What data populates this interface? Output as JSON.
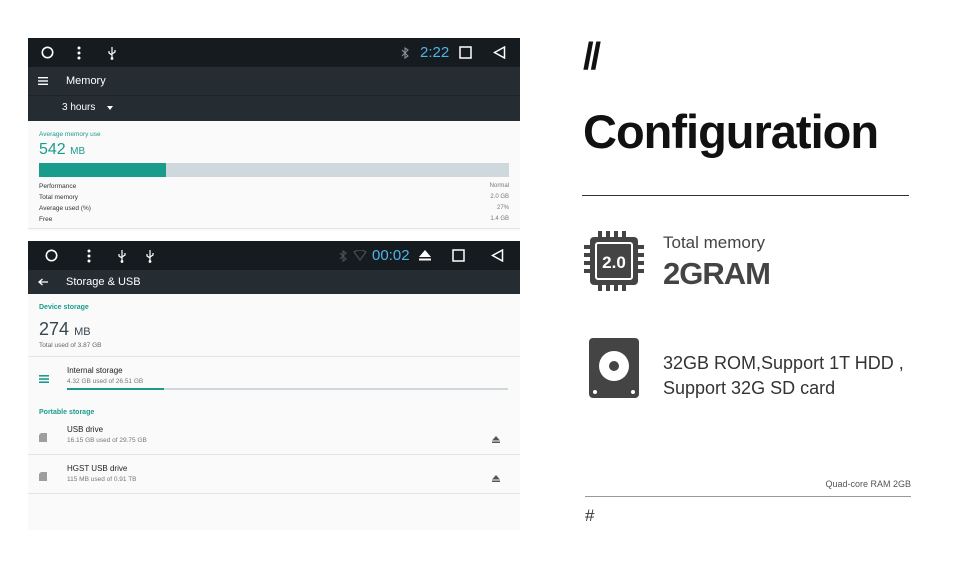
{
  "memory_panel": {
    "status_bar": {
      "time": "2:22"
    },
    "app_bar": {
      "title": "Memory"
    },
    "period_dropdown": {
      "selected": "3 hours"
    },
    "average_caption": "Average memory use",
    "average_value": "542",
    "average_unit": "MB",
    "usage_fraction": 0.27,
    "stats": [
      {
        "label": "Performance",
        "value": "Normal"
      },
      {
        "label": "Total memory",
        "value": "2.0 GB"
      },
      {
        "label": "Average used (%)",
        "value": "27%"
      },
      {
        "label": "Free",
        "value": "1.4 GB"
      }
    ]
  },
  "storage_panel": {
    "status_bar": {
      "time": "00:02"
    },
    "app_bar": {
      "title": "Storage & USB"
    },
    "device_section": "Device storage",
    "used_value": "274",
    "used_unit": "MB",
    "used_sub": "Total used of 3.87 GB",
    "internal": {
      "title": "Internal storage",
      "sub": "4.32 GB used of 26.51 GB",
      "fraction": 0.22
    },
    "portable_section": "Portable storage",
    "portable_items": [
      {
        "title": "USB drive",
        "sub": "16.15 GB used of 29.75 GB"
      },
      {
        "title": "HGST USB drive",
        "sub": "115 MB used of 0.91 TB"
      }
    ]
  },
  "config": {
    "slashes": "//",
    "heading": "Configuration",
    "chip_label": "2.0",
    "total_memory_label": "Total memory",
    "total_memory_value": "2GRAM",
    "rom_line1": "32GB ROM,Support 1T HDD ,",
    "rom_line2": "Support 32G SD card",
    "footnote": "Quad-core RAM 2GB",
    "hash": "#"
  },
  "colors": {
    "accent_teal": "#1a9c8c",
    "clock_blue": "#4fb3e8",
    "bar_dark": "#161b1f",
    "appbar": "#262d32"
  }
}
